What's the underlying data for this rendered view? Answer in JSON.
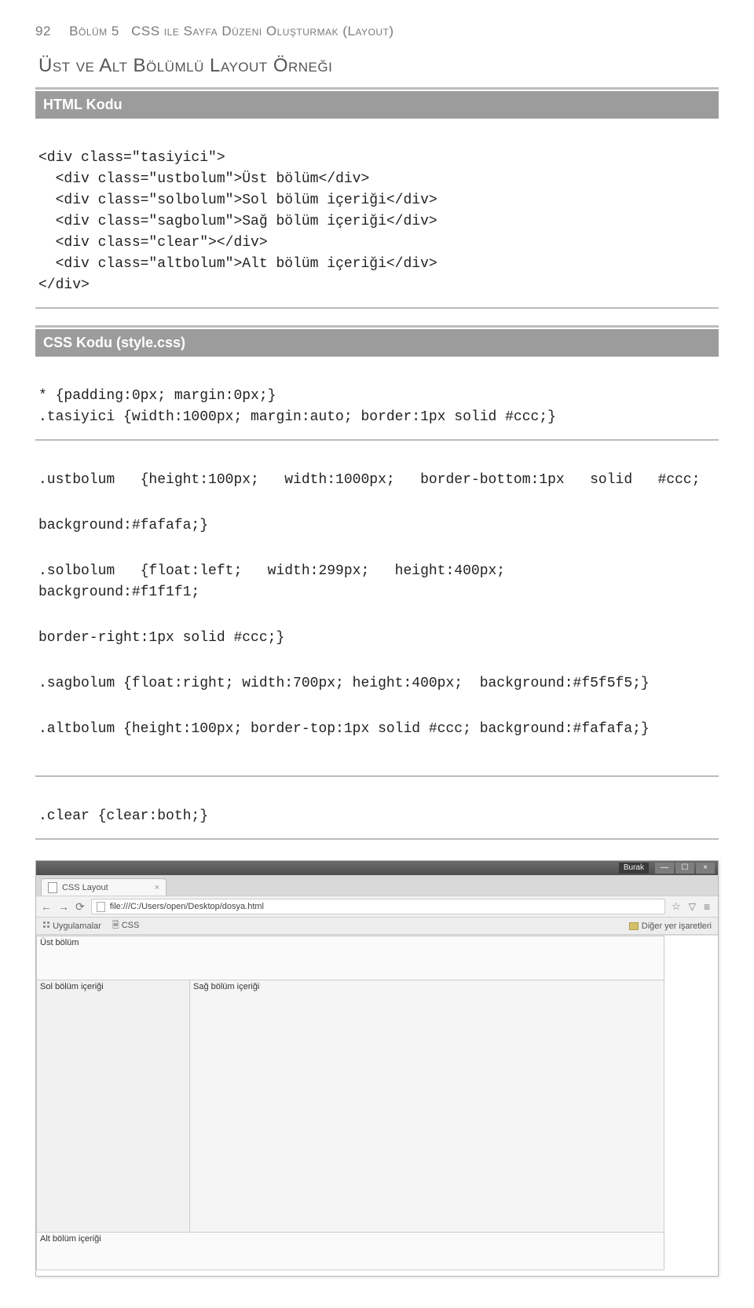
{
  "header": {
    "page_number": "92",
    "chapter_label": "Bölüm 5",
    "chapter_title": "CSS ile Sayfa Düzeni Oluşturmak (Layout)"
  },
  "section_title": "Üst ve Alt Bölümlü Layout Örneği",
  "html_code": {
    "heading": "HTML Kodu",
    "lines": [
      "<div class=\"tasiyici\">",
      "  <div class=\"ustbolum\">Üst bölüm</div>",
      "  <div class=\"solbolum\">Sol bölüm içeriği</div>",
      "  <div class=\"sagbolum\">Sağ bölüm içeriği</div>",
      "  <div class=\"clear\"></div>",
      "  <div class=\"altbolum\">Alt bölüm içeriği</div>",
      "</div>"
    ]
  },
  "css_code": {
    "heading": "CSS Kodu (style.css)",
    "block1": [
      "* {padding:0px; margin:0px;}",
      ".tasiyici {width:1000px; margin:auto; border:1px solid #ccc;}"
    ],
    "block2_l1a": ".ustbolum   {height:100px;   width:1000px;   border-bottom:1px   solid   #ccc;",
    "block2_l1b": "background:#fafafa;}",
    "block2_l2a": ".solbolum   {float:left;   width:299px;   height:400px;       background:#f1f1f1;",
    "block2_l2b": "border-right:1px solid #ccc;}",
    "block2_l3": ".sagbolum {float:right; width:700px; height:400px;  background:#f5f5f5;}",
    "block2_l4": ".altbolum {height:100px; border-top:1px solid #ccc; background:#fafafa;}",
    "block3": ".clear {clear:both;}"
  },
  "browser": {
    "user": "Burak",
    "win_min": "—",
    "win_max": "☐",
    "win_close": "×",
    "tab_title": "CSS Layout",
    "tab_close": "×",
    "nav_back": "←",
    "nav_fwd": "→",
    "nav_reload": "⟳",
    "url": "file:///C:/Users/open/Desktop/dosya.html",
    "bm_apps": "Uygulamalar",
    "bm_css": "CSS",
    "bm_other": "Diğer yer işaretleri",
    "demo": {
      "ust": "Üst bölüm",
      "sol": "Sol bölüm içeriği",
      "sag": "Sağ bölüm içeriği",
      "alt": "Alt bölüm içeriği"
    }
  }
}
